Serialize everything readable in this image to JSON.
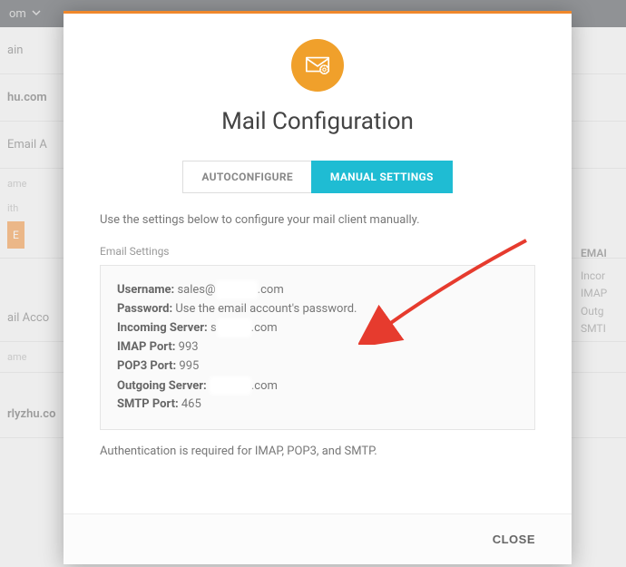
{
  "topbar": {
    "domain_suffix": "om"
  },
  "bg": {
    "row1": "ain",
    "row2": "hu.com",
    "row3": "Email A",
    "col_name": "ame",
    "col_with": "ith",
    "btn": "E",
    "row4": "ail Acco",
    "col_name2": "ame",
    "row5": "rlyzhu.co",
    "right": {
      "hdr": "EMAI",
      "l1": "Incor",
      "l2": "IMAP",
      "l3": "Outg",
      "l4": "SMTI"
    }
  },
  "modal": {
    "title": "Mail Configuration",
    "tabs": {
      "auto": "AUTOCONFIGURE",
      "manual": "MANUAL SETTINGS"
    },
    "instruction": "Use the settings below to configure your mail client manually.",
    "section_label": "Email Settings",
    "settings": {
      "username_label": "Username:",
      "username_prefix": "sales@",
      "username_suffix": ".com",
      "password_label": "Password:",
      "password_value": "Use the email account's password.",
      "incoming_label": "Incoming Server:",
      "incoming_prefix": "s",
      "incoming_suffix": ".com",
      "imap_label": "IMAP Port:",
      "imap_value": "993",
      "pop3_label": "POP3 Port:",
      "pop3_value": "995",
      "outgoing_label": "Outgoing Server:",
      "outgoing_suffix": ".com",
      "smtp_label": "SMTP Port:",
      "smtp_value": "465"
    },
    "auth_note": "Authentication is required for IMAP, POP3, and SMTP.",
    "close": "CLOSE"
  }
}
